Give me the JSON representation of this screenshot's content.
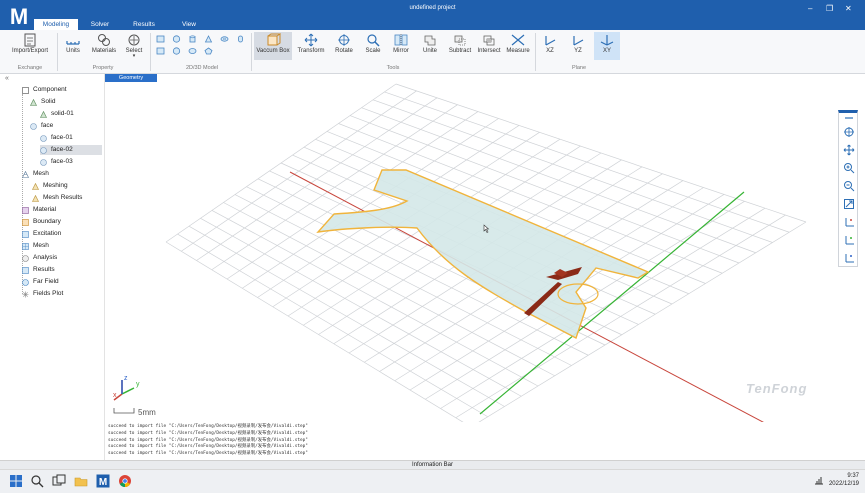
{
  "app": {
    "logo": "M",
    "title": "undefined project",
    "window_controls": [
      "minimize-icon",
      "restore-icon",
      "close-icon"
    ]
  },
  "menu": {
    "tabs": [
      "Modeling",
      "Solver",
      "Results",
      "View"
    ],
    "active": "Modeling"
  },
  "ribbon": {
    "buttons": {
      "import_export": "Import/Export",
      "units": "Units",
      "materials": "Materials",
      "select": "Select",
      "vaccum_box": "Vaccum Box",
      "transform": "Transform",
      "rotate": "Rotate",
      "scale": "Scale",
      "mirror": "Mirror",
      "unite": "Unite",
      "subtract": "Subtract",
      "intersect": "Intersect",
      "measure": "Measure",
      "xz": "XZ",
      "yz": "YZ",
      "xy": "XY"
    },
    "groups": {
      "exchange": "Exchange",
      "property": "Property",
      "model": "2D/3D Model",
      "tools": "Tools",
      "plane": "Plane"
    }
  },
  "geometry_tab": "Geometry",
  "tree": {
    "component": "Component",
    "solid": "Solid",
    "solid_01": "solid-01",
    "face": "face",
    "face_01": "face-01",
    "face_02": "face-02",
    "face_03": "face-03",
    "mesh_group": "Mesh",
    "meshing": "Meshing",
    "mesh_results": "Mesh Results",
    "material": "Material",
    "boundary": "Boundary",
    "excitation": "Excitation",
    "mesh": "Mesh",
    "analysis": "Analysis",
    "results": "Results",
    "far_field": "Far Field",
    "fields_plot": "Fields Plot",
    "selected": "face-02"
  },
  "viewport": {
    "axis_labels": {
      "x": "x",
      "y": "y",
      "z": "z"
    },
    "scale_label": "5mm",
    "watermark": "TenFong",
    "colors": {
      "substrate_fill": "#d4e8e8",
      "substrate_outline": "#f0b43c",
      "feed_fill": "#8b2a17",
      "x_axis": "#c8463c",
      "y_axis": "#37b435",
      "grid": "#cfd2d6"
    }
  },
  "console": {
    "lines": [
      "succeed to import file \"C:/Users/TenFong/Desktop/视频录制/发布会/Vivaldi.step\"",
      "succeed to import file \"C:/Users/TenFong/Desktop/视频录制/发布会/Vivaldi.step\"",
      "succeed to import file \"C:/Users/TenFong/Desktop/视频录制/发布会/Vivaldi.step\"",
      "succeed to import file \"C:/Users/TenFong/Desktop/视频录制/发布会/Vivaldi.step\"",
      "succeed to import file \"C:/Users/TenFong/Desktop/视频录制/发布会/Vivaldi.step\""
    ]
  },
  "info_bar": "Information Bar",
  "taskbar": {
    "time": "9:37",
    "date": "2022/12/19",
    "icons": [
      "windows-icon",
      "search-icon",
      "task-view-icon",
      "file-explorer-icon",
      "app-m-icon",
      "chrome-icon"
    ]
  }
}
